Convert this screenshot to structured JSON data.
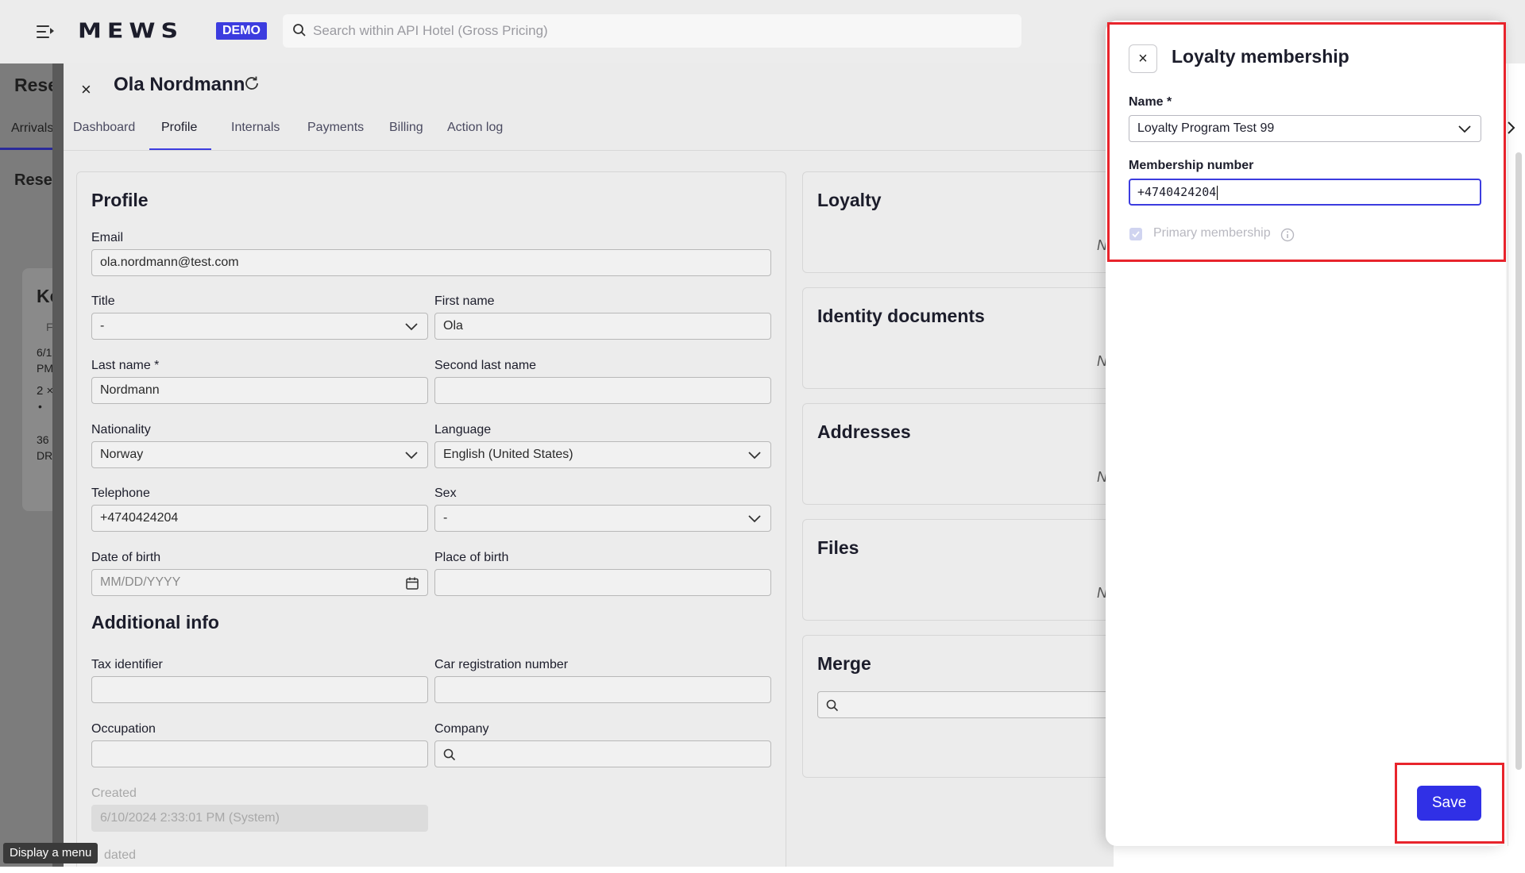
{
  "topbar": {
    "logo": "MEWS",
    "badge": "DEMO",
    "search_placeholder": "Search within API Hotel (Gross Pricing)"
  },
  "background": {
    "heading1": "Rese",
    "tab": "Arrivals",
    "heading2": "Rese",
    "card_initials": "Ko",
    "card_chip": "Fi",
    "card_date": "6/1",
    "card_time": "PM",
    "card_count": "2 ×",
    "card_bullet": "•",
    "card_num": "36",
    "card_code": "DR"
  },
  "profile_header": {
    "guest_name": "Ola Nordmann",
    "close": "×"
  },
  "tabs": [
    "Dashboard",
    "Profile",
    "Internals",
    "Payments",
    "Billing",
    "Action log"
  ],
  "profile": {
    "title": "Profile",
    "email_label": "Email",
    "email": "ola.nordmann@test.com",
    "title_label": "Title",
    "title_value": "-",
    "first_name_label": "First name",
    "first_name": "Ola",
    "last_name_label": "Last name *",
    "last_name": "Nordmann",
    "second_last_name_label": "Second last name",
    "second_last_name": "",
    "nationality_label": "Nationality",
    "nationality": "Norway",
    "language_label": "Language",
    "language": "English (United States)",
    "telephone_label": "Telephone",
    "telephone": "+4740424204",
    "sex_label": "Sex",
    "sex": "-",
    "dob_label": "Date of birth",
    "dob_placeholder": "MM/DD/YYYY",
    "pob_label": "Place of birth",
    "pob": ""
  },
  "additional": {
    "title": "Additional info",
    "tax_label": "Tax identifier",
    "car_label": "Car registration number",
    "occupation_label": "Occupation",
    "company_label": "Company",
    "created_label": "Created",
    "created_value": "6/10/2024 2:33:01 PM (System)",
    "updated_label": "dated"
  },
  "right_cards": {
    "loyalty": "Loyalty",
    "identity": "Identity documents",
    "addresses": "Addresses",
    "files": "Files",
    "merge": "Merge",
    "truncated": "N"
  },
  "drawer": {
    "title": "Loyalty membership",
    "close": "×",
    "name_label": "Name *",
    "name_value": "Loyalty Program Test 99",
    "number_label": "Membership number",
    "number_value": "+4740424204",
    "primary_label": "Primary membership",
    "save_label": "Save"
  },
  "tooltip": "Display a menu",
  "colors": {
    "accent": "#3c3cdf",
    "highlight": "#e8242c"
  }
}
